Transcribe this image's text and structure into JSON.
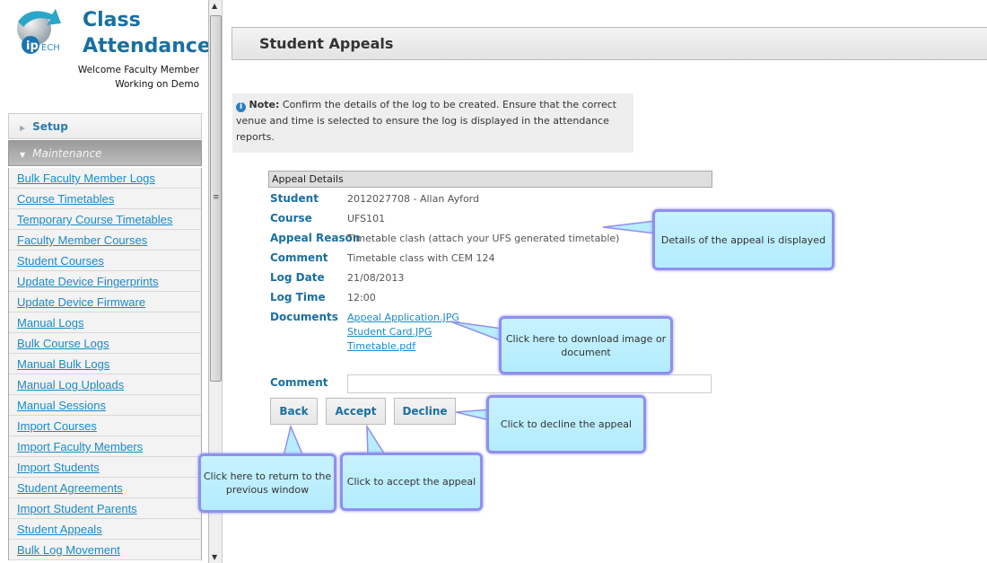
{
  "app": {
    "title_line1": "Class",
    "title_line2": "Attendance",
    "logo_text": "ECH",
    "welcome": "Welcome Faculty Member",
    "working_on": "Working on Demo"
  },
  "sidebar": {
    "sections": [
      {
        "label": "Setup",
        "expanded": false
      },
      {
        "label": "Maintenance",
        "expanded": true
      }
    ],
    "items": [
      "Bulk Faculty Member Logs",
      "Course Timetables",
      "Temporary Course Timetables",
      "Faculty Member Courses",
      "Student Courses",
      "Update Device Fingerprints",
      "Update Device Firmware",
      "Manual Logs",
      "Bulk Course Logs",
      "Manual Bulk Logs",
      "Manual Log Uploads",
      "Manual Sessions",
      "Import Courses",
      "Import Faculty Members",
      "Import Students",
      "Student Agreements",
      "Import Student Parents",
      "Student Appeals",
      "Bulk Log Movement"
    ]
  },
  "page": {
    "title": "Student Appeals",
    "note_label": "Note:",
    "note_text": " Confirm the details of the log to be created. Ensure that the correct venue and time is selected to ensure the log is displayed in the attendance reports."
  },
  "details": {
    "header": "Appeal Details",
    "student_label": "Student",
    "student": "2012027708 - Allan Ayford",
    "course_label": "Course",
    "course": "UFS101",
    "reason_label": "Appeal Reason",
    "reason": "Timetable clash (attach your UFS generated timetable)",
    "comment_label": "Comment",
    "comment": "Timetable class with CEM 124",
    "log_date_label": "Log Date",
    "log_date": "21/08/2013",
    "log_time_label": "Log Time",
    "log_time": "12:00",
    "documents_label": "Documents",
    "documents": [
      "Appeal Application.JPG",
      "Student Card.JPG",
      "Timetable.pdf"
    ]
  },
  "form": {
    "comment_label": "Comment",
    "comment_value": "",
    "back_label": "Back",
    "accept_label": "Accept",
    "decline_label": "Decline"
  },
  "callouts": {
    "details": "Details of the appeal is displayed",
    "download": "Click here to download image or document",
    "decline": "Click to decline the appeal",
    "back": "Click here to return to the previous window",
    "accept": "Click to accept the appeal"
  }
}
